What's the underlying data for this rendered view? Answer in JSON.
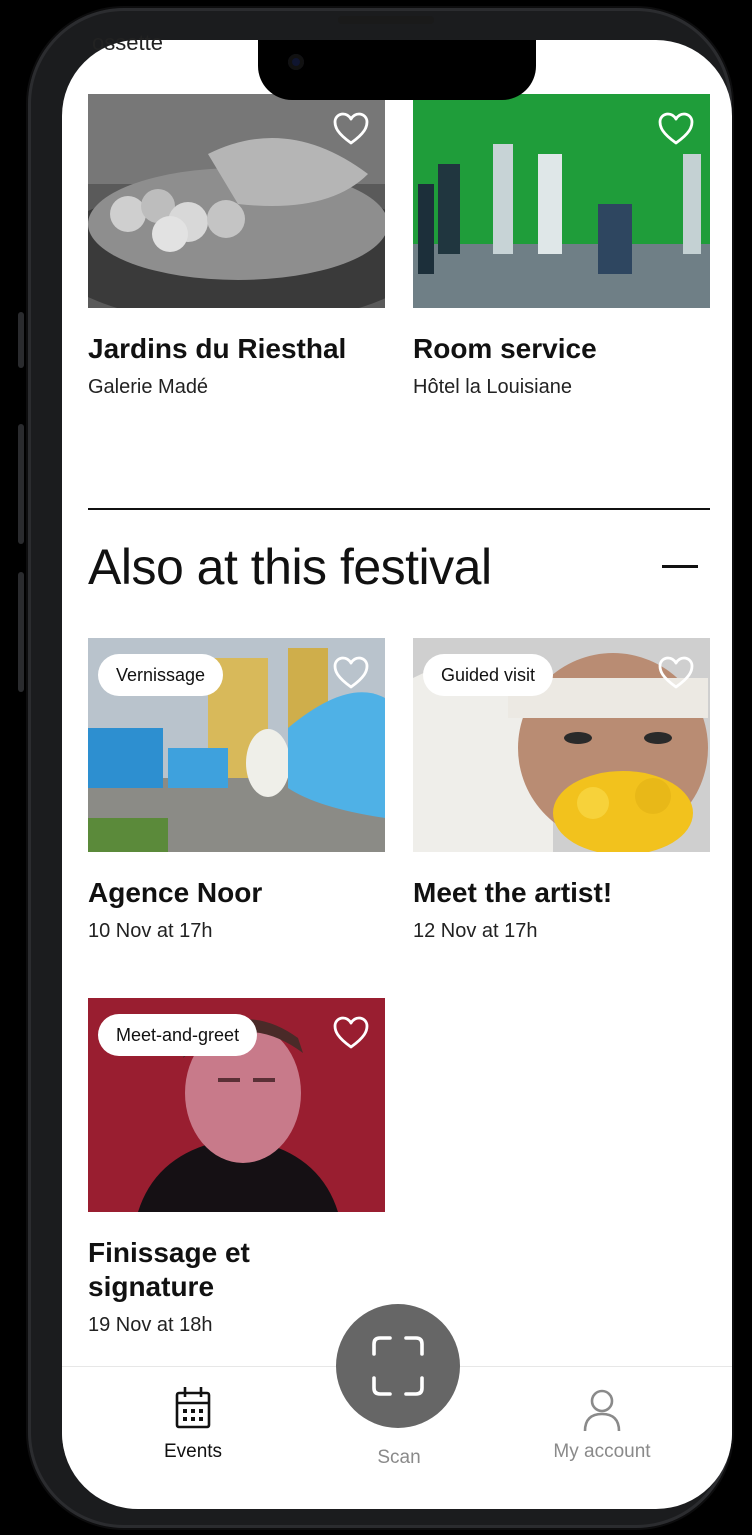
{
  "top_cutoff_text": "ossette",
  "artworks": [
    {
      "title": "Jardins du Riesthal",
      "venue": "Galerie Madé"
    },
    {
      "title": "Room service",
      "venue": "Hôtel la Louisiane"
    }
  ],
  "section": {
    "title": "Also at this festival"
  },
  "events": [
    {
      "tag": "Vernissage",
      "title": "Agence Noor",
      "date": "10 Nov at 17h"
    },
    {
      "tag": "Guided visit",
      "title": "Meet the artist!",
      "date": "12 Nov at 17h"
    },
    {
      "tag": "Meet-and-greet",
      "title": "Finissage et signature",
      "date": "19 Nov at 18h"
    }
  ],
  "tabbar": {
    "events_label": "Events",
    "scan_label": "Scan",
    "account_label": "My account"
  },
  "icons": {
    "heart": "heart-outline-icon",
    "calendar": "calendar-icon",
    "scan": "scan-frame-icon",
    "user": "user-icon",
    "collapse": "minus-icon"
  },
  "colors": {
    "active_tab": "#111111",
    "inactive_tab": "#8a8a8a",
    "scan_button": "#666666",
    "forest_green": "#1f9d3a"
  }
}
